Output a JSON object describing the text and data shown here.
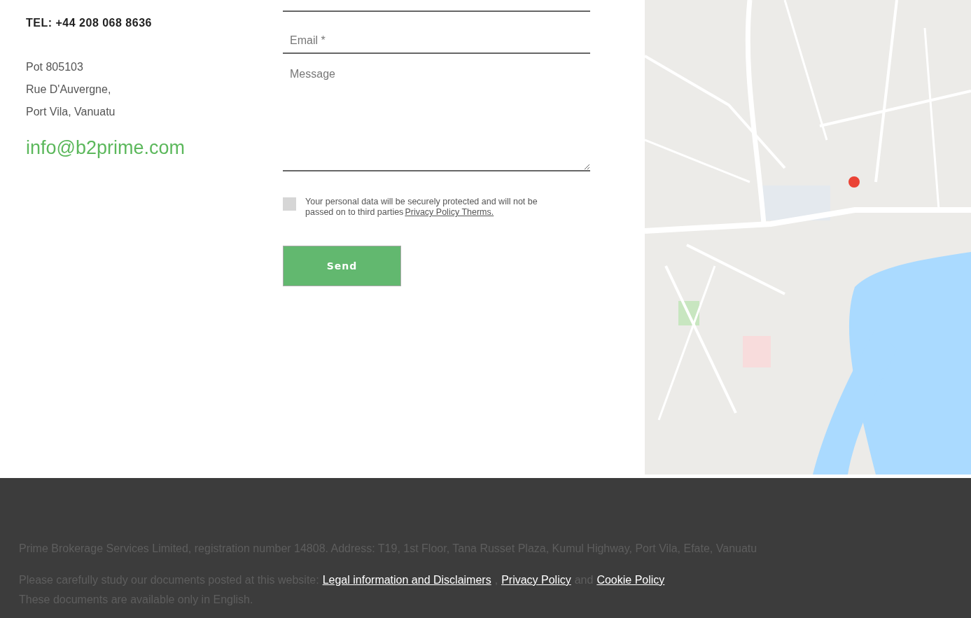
{
  "contact": {
    "phone": "TEL: +44 208 068 8636",
    "address": [
      "Pot 805103",
      "Rue D'Auvergne,",
      "Port Vila, Vanuatu"
    ],
    "email": "info@b2prime.com"
  },
  "form": {
    "fields": [
      {
        "kind": "cut"
      },
      {
        "kind": "input",
        "placeholder": "Email *"
      },
      {
        "kind": "textarea",
        "placeholder": "Message"
      }
    ],
    "consent": {
      "checked": false,
      "text": "Your personal data will be securely protected and will not be passed on to third parties",
      "link": "Privacy Policy Therms."
    },
    "submit": "Send"
  },
  "footer": {
    "company": "Prime Brokerage Services Limited, registration number 14808. Address: T19, 1st Floor, Tana Russet Plaza, Kumul Highway, Port Vila, Efate, Vanuatu",
    "notice": "Please carefully study our documents posted at this website:",
    "links": [
      {
        "label": "Legal information and Disclaimers",
        "after": ","
      },
      {
        "label": "Privacy Policy",
        "after": "and"
      },
      {
        "label": "Cookie Policy"
      }
    ],
    "language_note": "These documents are available only in English."
  }
}
